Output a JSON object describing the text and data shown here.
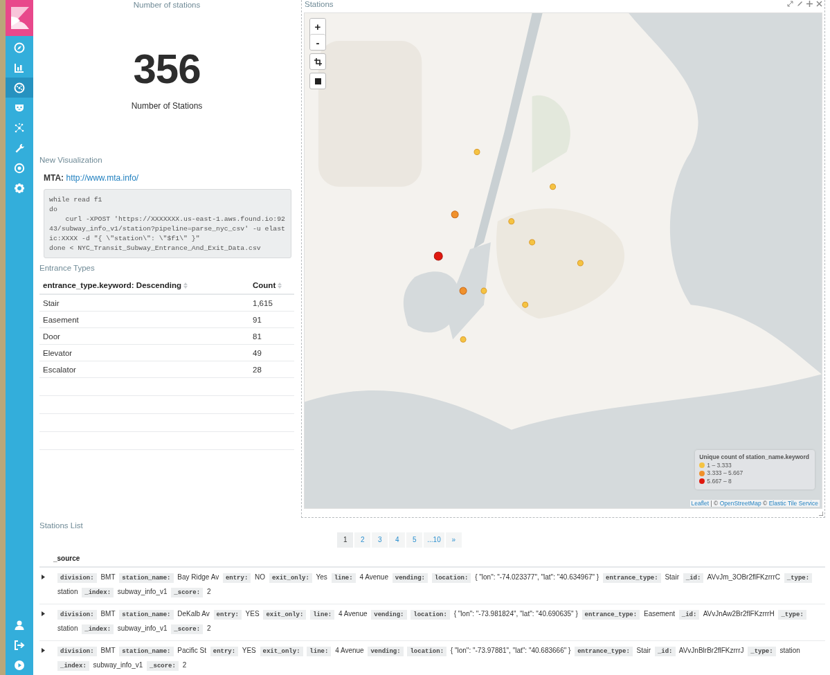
{
  "sidebar": {
    "nav": [
      {
        "selected": false
      },
      {
        "selected": false
      },
      {
        "selected": true
      },
      {
        "selected": false
      },
      {
        "selected": false
      },
      {
        "selected": false
      },
      {
        "selected": false
      },
      {
        "selected": false
      }
    ],
    "bottom": [
      {
        "selected": false
      },
      {
        "selected": false
      },
      {
        "selected": false
      }
    ]
  },
  "metric_panel": {
    "title": "Number of stations",
    "value": "356",
    "label": "Number of Stations"
  },
  "markdown_panel": {
    "title": "New Visualization",
    "source_label": "MTA:",
    "source_link": "http://www.mta.info/",
    "code": "while read f1\ndo\n    curl -XPOST 'https://XXXXXXX.us-east-1.aws.found.io:9243/subway_info_v1/station?pipeline=parse_nyc_csv' -u elastic:XXXX -d \"{ \\\"station\\\": \\\"$f1\\\" }\"\ndone < NYC_Transit_Subway_Entrance_And_Exit_Data.csv"
  },
  "table_panel": {
    "title": "Entrance Types",
    "columns": [
      "entrance_type.keyword: Descending",
      "Count"
    ],
    "rows": [
      [
        "Stair",
        "1,615"
      ],
      [
        "Easement",
        "91"
      ],
      [
        "Door",
        "81"
      ],
      [
        "Elevator",
        "49"
      ],
      [
        "Escalator",
        "28"
      ]
    ]
  },
  "map_panel": {
    "title": "Stations",
    "zoom_in": "+",
    "zoom_out": "-",
    "legend": {
      "title": "Unique count of station_name.keyword",
      "items": [
        {
          "label": "1 – 3.333",
          "color": "#f5c342"
        },
        {
          "label": "3.333 – 5.667",
          "color": "#f0912c"
        },
        {
          "label": "5.667 – 8",
          "color": "#e0180f"
        }
      ]
    },
    "attribution": [
      {
        "kind": "link",
        "text": "Leaflet"
      },
      {
        "kind": "text",
        "text": " | © "
      },
      {
        "kind": "link",
        "text": "OpenStreetMap"
      },
      {
        "kind": "text",
        "text": " © "
      },
      {
        "kind": "link",
        "text": "Elastic Tile Service"
      }
    ]
  },
  "search_panel": {
    "title": "Stations List",
    "pages": [
      {
        "label": "1",
        "selected": true
      },
      {
        "label": "2",
        "selected": false
      },
      {
        "label": "3",
        "selected": false
      },
      {
        "label": "4",
        "selected": false
      },
      {
        "label": "5",
        "selected": false
      },
      {
        "label": "...10",
        "selected": false
      },
      {
        "label": "»",
        "selected": false
      }
    ],
    "column": "_source",
    "docs": [
      {
        "expanded": false,
        "fields": [
          {
            "key": "division:",
            "value": "BMT"
          },
          {
            "key": "station_name:",
            "value": "Bay Ridge Av"
          },
          {
            "key": "entry:",
            "value": "NO"
          },
          {
            "key": "exit_only:",
            "value": "Yes"
          },
          {
            "key": "line:",
            "value": "4 Avenue"
          },
          {
            "key": "vending:"
          },
          {
            "key": "location:",
            "value": "{ \"lon\": \"-74.023377\", \"lat\": \"40.634967\" }"
          },
          {
            "key": "entrance_type:",
            "value": "Stair"
          },
          {
            "key": "_id:",
            "value": "AVvJm_3OBr2flFKzrrrC"
          },
          {
            "key": "_type:",
            "value": "station"
          },
          {
            "key": "_index:",
            "value": "subway_info_v1"
          },
          {
            "key": "_score:",
            "value": "2"
          }
        ]
      },
      {
        "expanded": false,
        "fields": [
          {
            "key": "division:",
            "value": "BMT"
          },
          {
            "key": "station_name:",
            "value": "DeKalb Av"
          },
          {
            "key": "entry:",
            "value": "YES"
          },
          {
            "key": "exit_only:"
          },
          {
            "key": "line:",
            "value": "4 Avenue"
          },
          {
            "key": "vending:"
          },
          {
            "key": "location:",
            "value": "{ \"lon\": \"-73.981824\", \"lat\": \"40.690635\" }"
          },
          {
            "key": "entrance_type:",
            "value": "Easement"
          },
          {
            "key": "_id:",
            "value": "AVvJnAw2Br2flFKzrrrH"
          },
          {
            "key": "_type:",
            "value": "station"
          },
          {
            "key": "_index:",
            "value": "subway_info_v1"
          },
          {
            "key": "_score:",
            "value": "2"
          }
        ]
      },
      {
        "expanded": false,
        "fields": [
          {
            "key": "division:",
            "value": "BMT"
          },
          {
            "key": "station_name:",
            "value": "Pacific St"
          },
          {
            "key": "entry:",
            "value": "YES"
          },
          {
            "key": "exit_only:"
          },
          {
            "key": "line:",
            "value": "4 Avenue"
          },
          {
            "key": "vending:"
          },
          {
            "key": "location:",
            "value": "{ \"lon\": \"-73.97881\", \"lat\": \"40.683666\" }"
          },
          {
            "key": "entrance_type:",
            "value": "Stair"
          },
          {
            "key": "_id:",
            "value": "AVvJnBlrBr2flFKzrrrJ"
          },
          {
            "key": "_type:",
            "value": "station"
          },
          {
            "key": "_index:",
            "value": "subway_info_v1"
          },
          {
            "key": "_score:",
            "value": "2"
          }
        ]
      }
    ]
  }
}
